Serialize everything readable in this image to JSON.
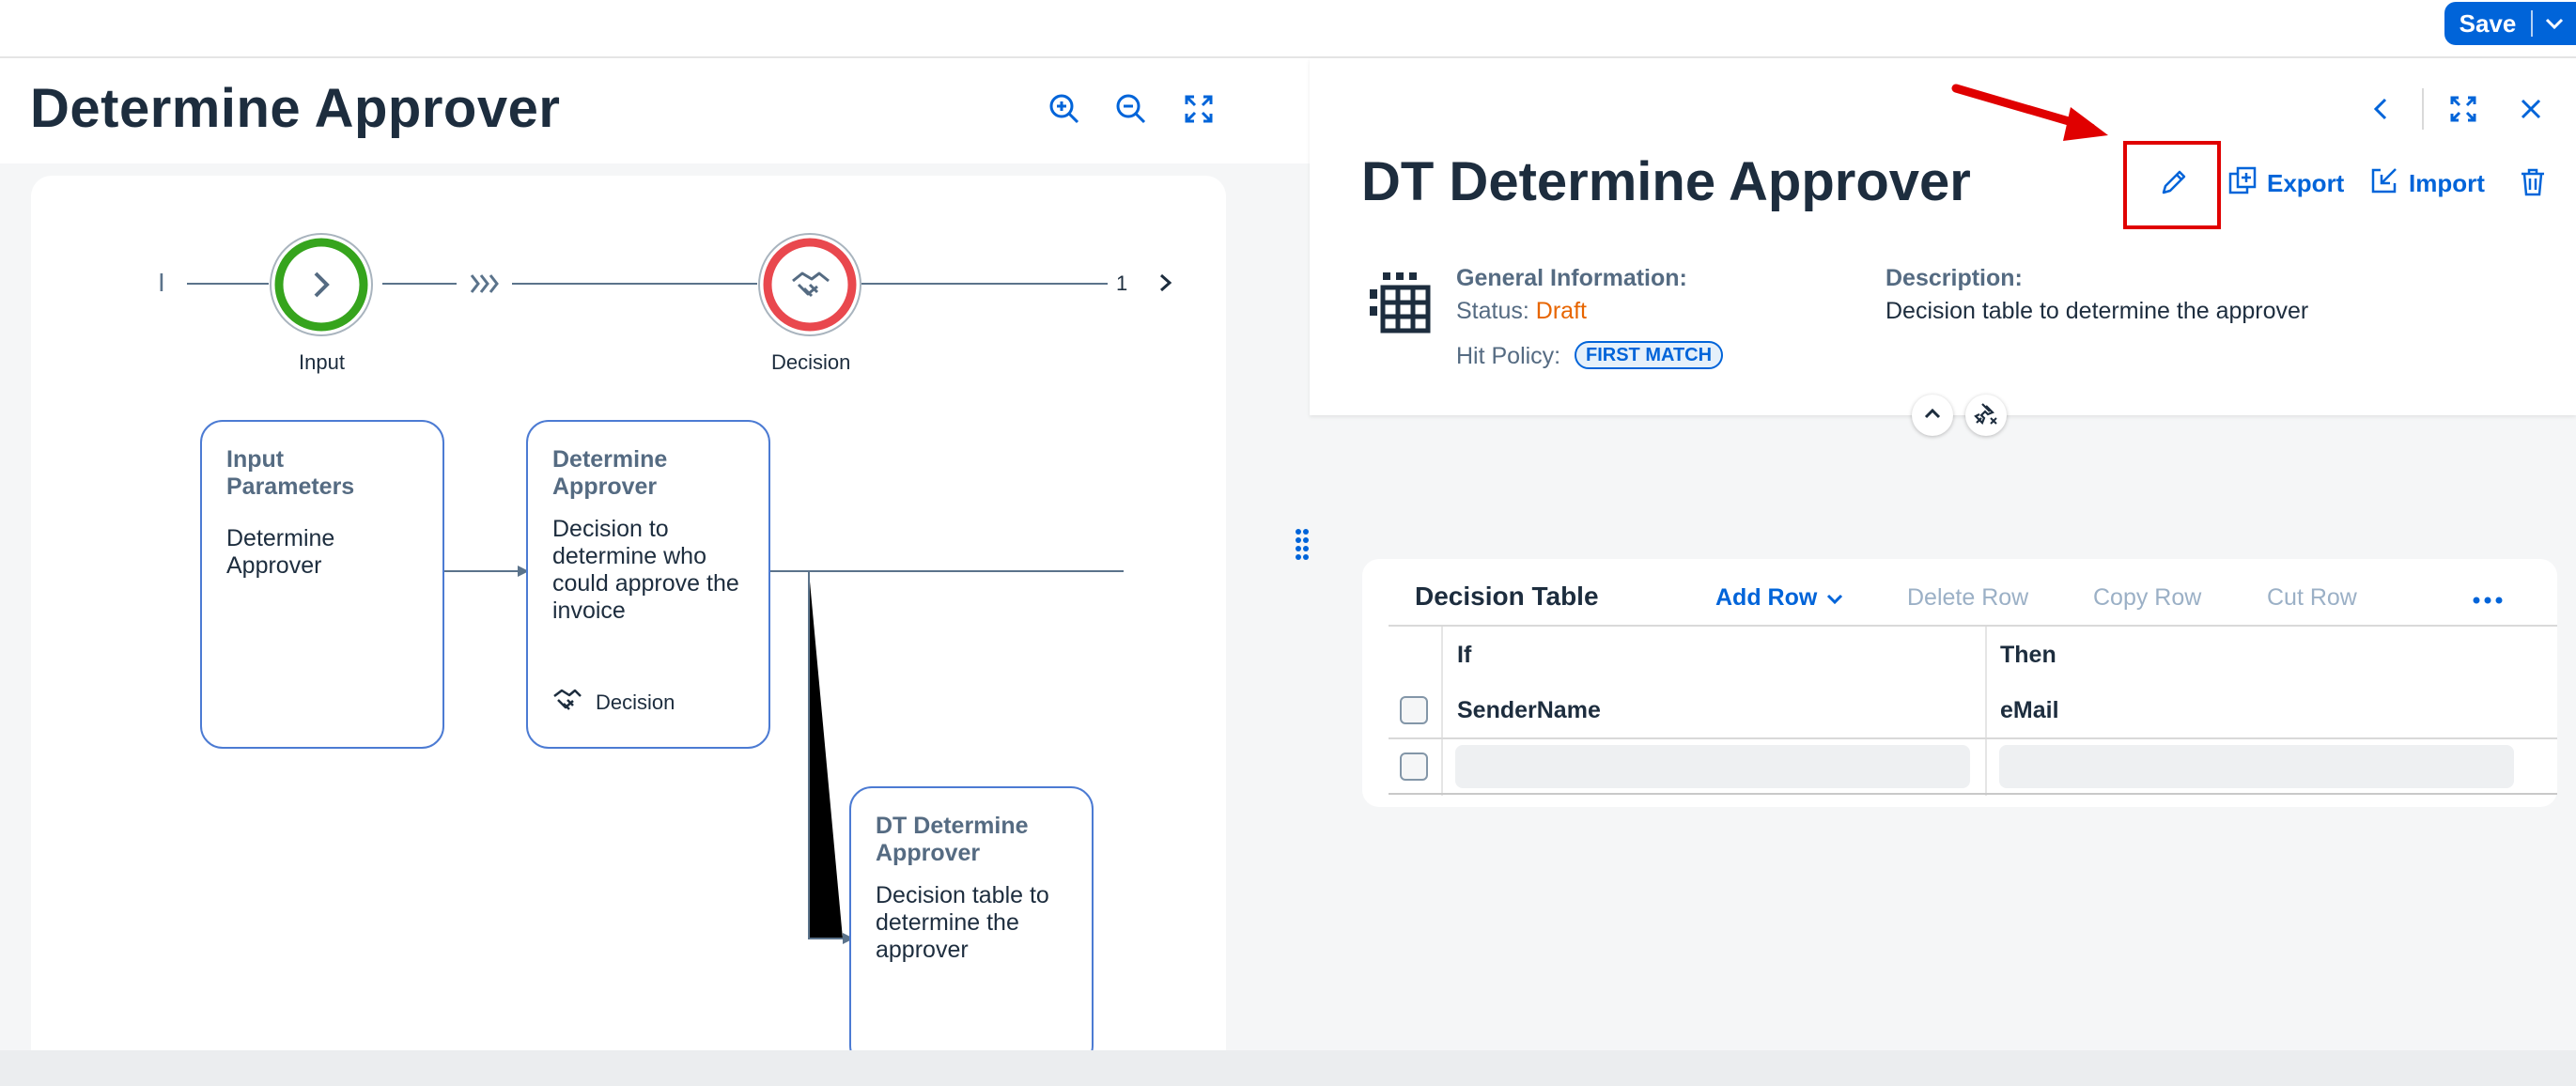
{
  "toolbar": {
    "save_label": "Save"
  },
  "left": {
    "title": "Determine Approver",
    "flow": {
      "start_marker": "I",
      "node_labels": [
        "Input",
        "Decision"
      ],
      "page_count": "1"
    },
    "cards": [
      {
        "title": "Input Parameters",
        "body": "Determine Approver"
      },
      {
        "title": "Determine Approver",
        "body": "Decision to determine who could approve the invoice",
        "footer": "Decision"
      },
      {
        "title": "DT Determine Approver",
        "body": "Decision table to determine the approver"
      }
    ]
  },
  "right": {
    "title": "DT Determine Approver",
    "actions": {
      "export": "Export",
      "import": "Import"
    },
    "general_label": "General Information:",
    "status_label": "Status:",
    "status_value": "Draft",
    "hit_policy_label": "Hit Policy:",
    "hit_policy_value": "FIRST MATCH",
    "description_label": "Description:",
    "description_value": "Decision table to determine the approver"
  },
  "table": {
    "title": "Decision Table",
    "add_row": "Add Row",
    "delete_row": "Delete Row",
    "copy_row": "Copy Row",
    "cut_row": "Cut Row",
    "if_label": "If",
    "then_label": "Then",
    "columns": [
      "SenderName",
      "eMail"
    ],
    "rows": [
      [
        "",
        ""
      ]
    ]
  },
  "colors": {
    "accent": "#0064d9",
    "status_draft": "#e76500",
    "start_node": "#36a41d",
    "decision_node": "#e9484e",
    "highlight": "#e00000"
  }
}
